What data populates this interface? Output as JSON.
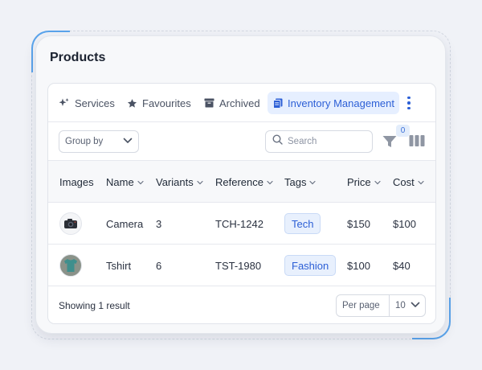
{
  "card": {
    "title": "Products"
  },
  "tabs": [
    {
      "label": "Services",
      "icon": "sparkle-icon",
      "active": false
    },
    {
      "label": "Favourites",
      "icon": "star-icon",
      "active": false
    },
    {
      "label": "Archived",
      "icon": "archive-icon",
      "active": false
    },
    {
      "label": "Inventory Management",
      "icon": "documents-icon",
      "active": true
    }
  ],
  "toolbar": {
    "group_by_label": "Group by",
    "search_placeholder": "Search",
    "filter_count": "0"
  },
  "table": {
    "columns": [
      "Images",
      "Name",
      "Variants",
      "Reference",
      "Tags",
      "Price",
      "Cost"
    ],
    "rows": [
      {
        "image": "camera-thumbnail",
        "name": "Camera",
        "variants": "3",
        "reference": "TCH-1242",
        "tag": "Tech",
        "price": "$150",
        "cost": "$100"
      },
      {
        "image": "tshirt-thumbnail",
        "name": "Tshirt",
        "variants": "6",
        "reference": "TST-1980",
        "tag": "Fashion",
        "price": "$100",
        "cost": "$40"
      }
    ]
  },
  "footer": {
    "result_text": "Showing 1 result",
    "per_page_label": "Per page",
    "per_page_value": "10"
  },
  "colors": {
    "accent": "#2c5fd6",
    "accent_bg": "#e6efff",
    "decor_accent": "#5aa4ec"
  }
}
